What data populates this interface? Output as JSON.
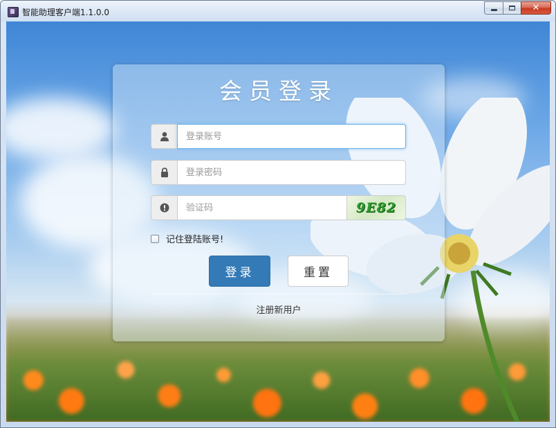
{
  "window": {
    "title": "智能助理客户端1.1.0.0",
    "close_glyph": "✕"
  },
  "login": {
    "title": "会员登录",
    "account_placeholder": "登录账号",
    "password_placeholder": "登录密码",
    "captcha_placeholder": "验证码",
    "captcha_code": "9E82",
    "remember_label": "记住登陆账号!",
    "remember_checked": false,
    "login_button": "登录",
    "reset_button": "重置",
    "register_link": "注册新用户"
  },
  "icons": {
    "account": "user-icon",
    "password": "lock-icon",
    "captcha": "exclamation-circle-icon"
  },
  "colors": {
    "primary": "#337ab7",
    "focus": "#66afe9",
    "captcha_text": "#2f9a2f"
  }
}
